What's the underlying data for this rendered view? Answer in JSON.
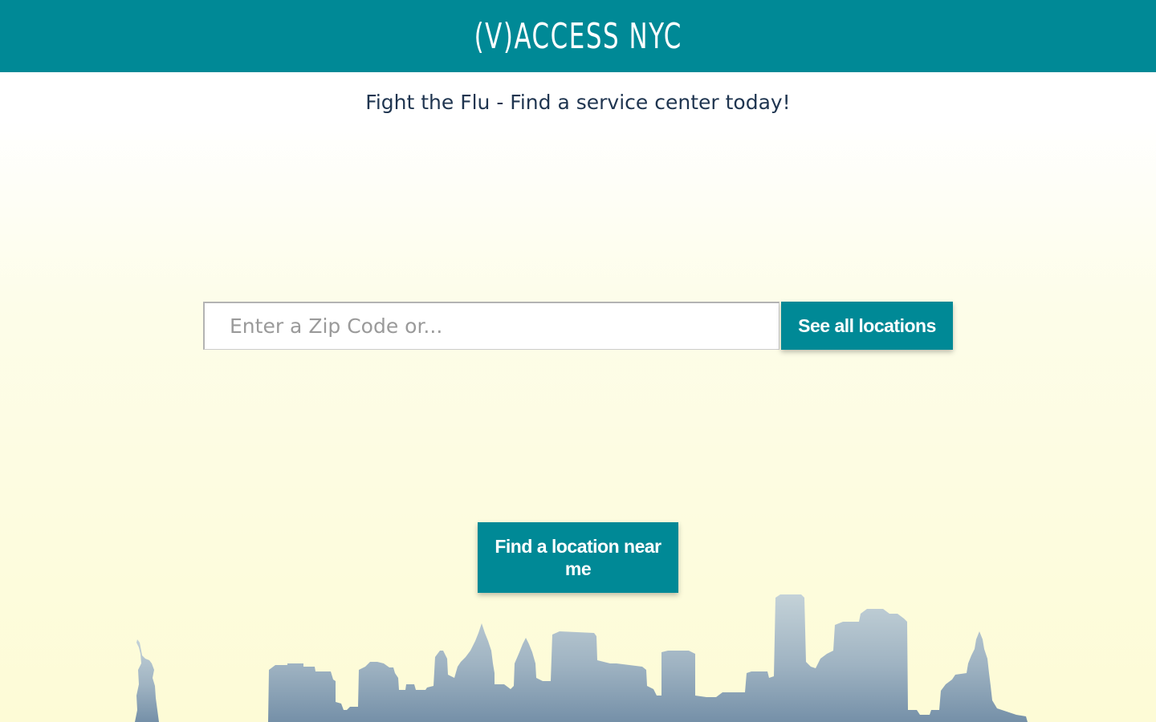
{
  "header": {
    "brand": "(V)ACCESS NYC",
    "background_color": "#008996"
  },
  "main": {
    "tagline": "Fight the Flu - Find a service center today!",
    "search": {
      "placeholder": "Enter a Zip Code or...",
      "value": ""
    },
    "see_all_label": "See all locations",
    "find_near_label": "Find a location near me"
  },
  "decor": {
    "skyline": "nyc-skyline-silhouette",
    "statue": "statue-of-liberty-silhouette"
  },
  "colors": {
    "accent": "#008996",
    "tagline_text": "#1f3550",
    "skyline": "#8aa2b4"
  }
}
